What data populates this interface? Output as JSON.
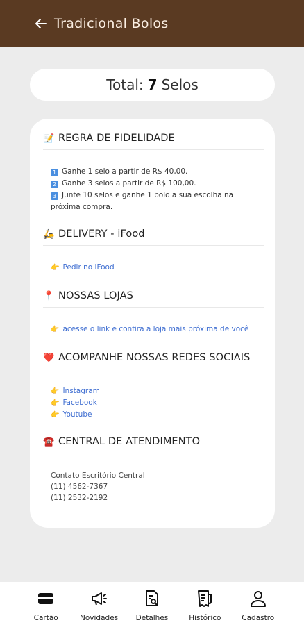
{
  "appbar": {
    "title": "Tradicional Bolos"
  },
  "total": {
    "prefix": "Total:",
    "value": "7",
    "suffix": "Selos"
  },
  "fidelidade": {
    "title": "REGRA DE FIDELIDADE",
    "lines": [
      "Ganhe 1 selo a partir de R$ 40,00.",
      "Ganhe 3 selos a partir de R$ 100,00.",
      "Junte 10 selos e ganhe 1 bolo a sua escolha na",
      "próxima compra."
    ],
    "numbers": [
      "1",
      "2",
      "3"
    ]
  },
  "delivery": {
    "title": "DELIVERY - iFood",
    "link": "Pedir no iFood"
  },
  "lojas": {
    "title": "NOSSAS LOJAS",
    "link": "acesse o link e confira a loja mais próxima de você"
  },
  "redes": {
    "title": "ACOMPANHE NOSSAS REDES SOCIAIS",
    "links": [
      "Instagram",
      "Facebook",
      "Youtube"
    ]
  },
  "atendimento": {
    "title": "CENTRAL DE ATENDIMENTO",
    "lines": [
      "Contato Escritório Central",
      "(11) 4562-7367",
      "(11) 2532-2192"
    ]
  },
  "nav": [
    "Cartão",
    "Novidades",
    "Detalhes",
    "Histórico",
    "Cadastro"
  ],
  "colors": {
    "appbar": "#5a3a22",
    "link": "#3f6ed1",
    "background": "#ececec"
  },
  "icons": [
    "back-arrow-icon",
    "memo-icon",
    "scooter-icon",
    "pin-icon",
    "heart-icon",
    "telephone-icon",
    "pointing-hand-icon",
    "card-icon",
    "megaphone-icon",
    "document-search-icon",
    "receipt-icon",
    "user-icon"
  ]
}
